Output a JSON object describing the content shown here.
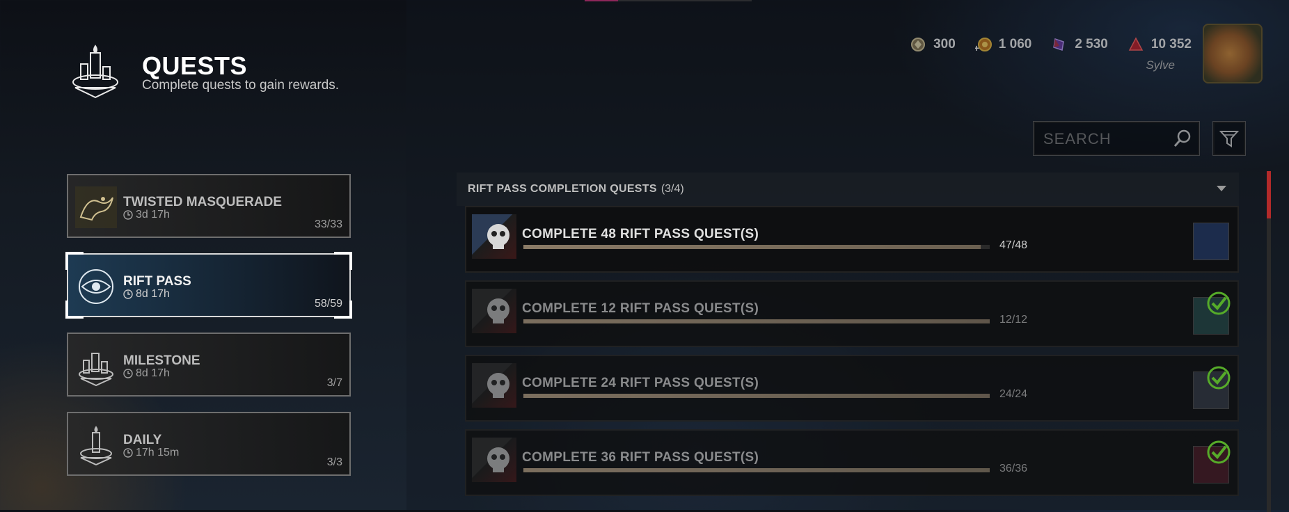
{
  "header": {
    "title": "QUESTS",
    "subtitle": "Complete quests to gain rewards."
  },
  "currencies": [
    {
      "name": "iridescent-shards-icon",
      "value": "300",
      "color": "#c9b27a"
    },
    {
      "name": "bloodpoints-icon",
      "value": "1 060",
      "color": "#d8a030"
    },
    {
      "name": "rift-fragments-icon",
      "value": "2 530",
      "color": "#7a4ac0"
    },
    {
      "name": "auric-cells-icon",
      "value": "10 352",
      "color": "#c0202a"
    }
  ],
  "user": {
    "name": "Sylve"
  },
  "search": {
    "placeholder": "SEARCH"
  },
  "categories": [
    {
      "name": "TWISTED MASQUERADE",
      "time": "3d 17h",
      "count": "33/33",
      "selected": false
    },
    {
      "name": "RIFT PASS",
      "time": "8d 17h",
      "count": "58/59",
      "selected": true
    },
    {
      "name": "MILESTONE",
      "time": "8d 17h",
      "count": "3/7",
      "selected": false
    },
    {
      "name": "DAILY",
      "time": "17h 15m",
      "count": "3/3",
      "selected": false
    }
  ],
  "group": {
    "title": "RIFT PASS COMPLETION QUESTS",
    "count": "(3/4)"
  },
  "quests": [
    {
      "title": "COMPLETE 48 RIFT PASS QUEST(S)",
      "progress_text": "47/48",
      "progress": 0.98,
      "completed": false,
      "reward_color": "#1c2c4c"
    },
    {
      "title": "COMPLETE 12 RIFT PASS QUEST(S)",
      "progress_text": "12/12",
      "progress": 1.0,
      "completed": true,
      "reward_color": "#1f3a3a"
    },
    {
      "title": "COMPLETE 24 RIFT PASS QUEST(S)",
      "progress_text": "24/24",
      "progress": 1.0,
      "completed": true,
      "reward_color": "#2a2f38"
    },
    {
      "title": "COMPLETE 36 RIFT PASS QUEST(S)",
      "progress_text": "36/36",
      "progress": 1.0,
      "completed": true,
      "reward_color": "#3a1820"
    }
  ],
  "colors": {
    "accent": "#d0307a",
    "check": "#5fbf2a",
    "scroll_thumb": "#b32a2a"
  }
}
